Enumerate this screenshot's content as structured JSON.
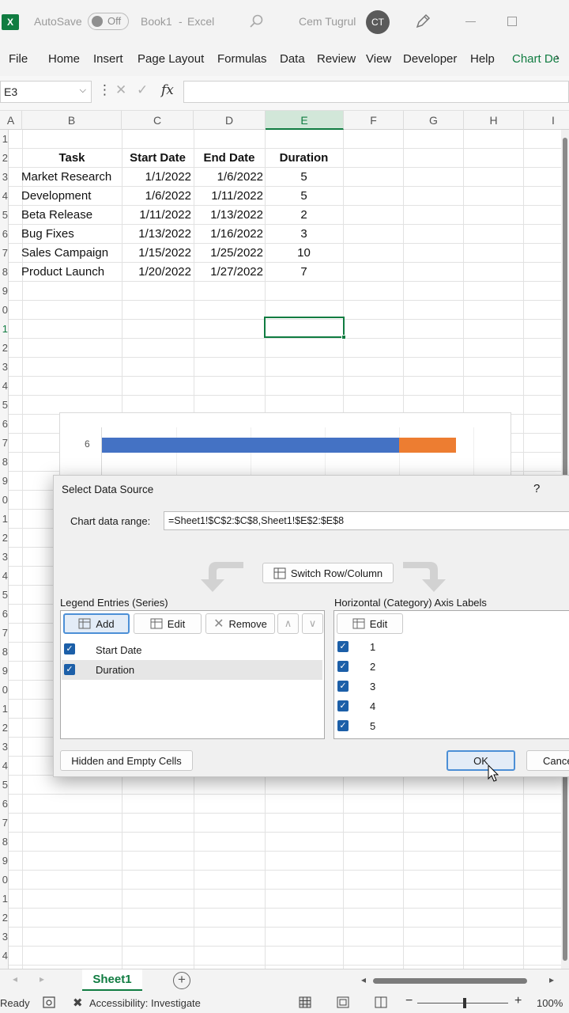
{
  "titlebar": {
    "app_logo": "X",
    "autosave_label": "AutoSave",
    "autosave_state": "Off",
    "doc_title": "Book1",
    "app_name": "Excel",
    "user_name": "Cem Tugrul",
    "user_initials": "CT"
  },
  "ribbon": {
    "tabs": [
      "File",
      "Home",
      "Insert",
      "Page Layout",
      "Formulas",
      "Data",
      "Review",
      "View",
      "Developer",
      "Help",
      "Chart De"
    ]
  },
  "formula_bar": {
    "name_box": "E3",
    "fx_label": "fx",
    "formula": ""
  },
  "grid": {
    "columns": [
      "A",
      "B",
      "C",
      "D",
      "E",
      "F",
      "G",
      "H",
      "I"
    ],
    "rows": [
      "1",
      "2",
      "3",
      "4",
      "5",
      "6",
      "7",
      "8",
      "9",
      "0",
      "1",
      "2",
      "3",
      "4",
      "5",
      "6",
      "7",
      "8",
      "9",
      "0",
      "1",
      "2",
      "3",
      "4",
      "5",
      "6",
      "7",
      "8",
      "9",
      "0",
      "1",
      "2",
      "3",
      "4",
      "5",
      "6",
      "7",
      "8",
      "9",
      "0",
      "1",
      "2",
      "3",
      "4"
    ],
    "headers": [
      "Task",
      "Start Date",
      "End Date",
      "Duration"
    ],
    "data": [
      [
        "Market Research",
        "1/1/2022",
        "1/6/2022",
        "5"
      ],
      [
        "Development",
        "1/6/2022",
        "1/11/2022",
        "5"
      ],
      [
        "Beta Release",
        "1/11/2022",
        "1/13/2022",
        "2"
      ],
      [
        "Bug Fixes",
        "1/13/2022",
        "1/16/2022",
        "3"
      ],
      [
        "Sales Campaign",
        "1/15/2022",
        "1/25/2022",
        "10"
      ],
      [
        "Product Launch",
        "1/20/2022",
        "1/27/2022",
        "7"
      ]
    ]
  },
  "chart": {
    "visible_category": "6",
    "colors": {
      "start": "#4472c4",
      "duration": "#ed7d31"
    }
  },
  "dialog": {
    "title": "Select Data Source",
    "help": "?",
    "range_label": "Chart data range:",
    "range_value": "=Sheet1!$C$2:$C$8,Sheet1!$E$2:$E$8",
    "switch_label": "Switch Row/Column",
    "legend_label": "Legend Entries (Series)",
    "axis_label": "Horizontal (Category) Axis Labels",
    "add_label": "Add",
    "edit_label": "Edit",
    "remove_label": "Remove",
    "axis_edit_label": "Edit",
    "series": [
      "Start Date",
      "Duration"
    ],
    "categories": [
      "1",
      "2",
      "3",
      "4",
      "5"
    ],
    "hidden_label": "Hidden and Empty Cells",
    "ok_label": "OK",
    "cancel_label": "Cance"
  },
  "sheet_tabs": {
    "active": "Sheet1"
  },
  "status": {
    "ready": "Ready",
    "accessibility": "Accessibility: Investigate",
    "zoom": "100%"
  }
}
